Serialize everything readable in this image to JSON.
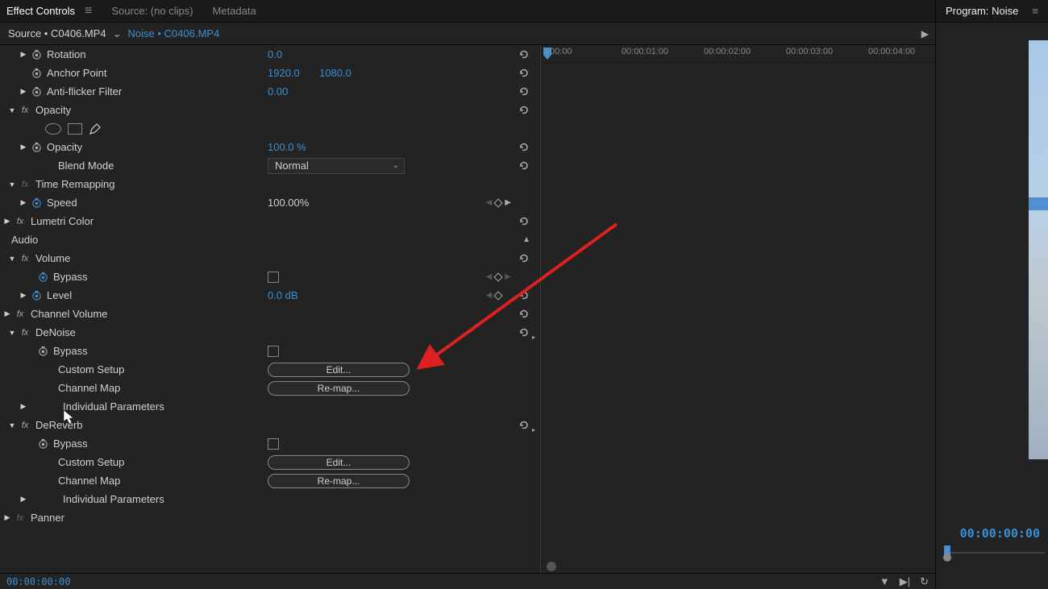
{
  "tabs": {
    "effectControls": "Effect Controls",
    "source": "Source: (no clips)",
    "metadata": "Metadata"
  },
  "sourceBar": {
    "source": "Source • C0406.MP4",
    "sequence": "Noise • C0406.MP4"
  },
  "timeline": {
    "ticks": [
      ":00:00",
      "00:00:01:00",
      "00:00:02:00",
      "00:00:03:00",
      "00:00:04:00"
    ]
  },
  "props": {
    "rotation": {
      "label": "Rotation",
      "value": "0.0"
    },
    "anchorPoint": {
      "label": "Anchor Point",
      "x": "1920.0",
      "y": "1080.0"
    },
    "antiFlicker": {
      "label": "Anti-flicker Filter",
      "value": "0.00"
    },
    "opacityHeader": "Opacity",
    "opacity": {
      "label": "Opacity",
      "value": "100.0 %"
    },
    "blendMode": {
      "label": "Blend Mode",
      "value": "Normal"
    },
    "timeRemapping": "Time Remapping",
    "speed": {
      "label": "Speed",
      "value": "100.00%"
    },
    "lumetriColor": "Lumetri Color",
    "audioSection": "Audio",
    "volume": "Volume",
    "bypass": "Bypass",
    "level": {
      "label": "Level",
      "value": "0.0 dB"
    },
    "channelVolume": "Channel Volume",
    "deNoise": "DeNoise",
    "customSetup": "Custom Setup",
    "channelMap": "Channel Map",
    "individualParameters": "Individual Parameters",
    "deReverb": "DeReverb",
    "panner": "Panner",
    "editButton": "Edit...",
    "remapButton": "Re-map..."
  },
  "bottomTimecode": "00:00:00:00",
  "program": {
    "title": "Program: Noise",
    "timecode": "00:00:00:00"
  }
}
